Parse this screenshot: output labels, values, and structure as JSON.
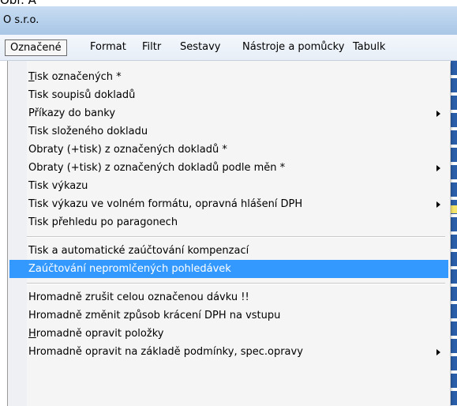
{
  "caption": "Obr. A",
  "window": {
    "title": "O s.r.o."
  },
  "menubar": {
    "items": [
      "Označené",
      "Format",
      "Filtr",
      "Sestavy",
      "Nástroje a pomůcky",
      "Tabulk"
    ]
  },
  "menu": {
    "groups": [
      [
        {
          "label": "Tisk označených *",
          "mnemonic": "T",
          "submenu": false
        },
        {
          "label": "Tisk soupisů dokladů",
          "submenu": false
        },
        {
          "label": "Příkazy do banky",
          "submenu": true
        },
        {
          "label": "Tisk složeného dokladu",
          "submenu": false
        },
        {
          "label": "Obraty  (+tisk) z označených dokladů *",
          "submenu": false
        },
        {
          "label": "Obraty  (+tisk) z označených dokladů podle měn *",
          "submenu": true
        },
        {
          "label": "Tisk  výkazu",
          "submenu": false
        },
        {
          "label": "Tisk výkazu ve volném formátu, opravná hlášení DPH",
          "submenu": true
        },
        {
          "label": "Tisk přehledu po paragonech",
          "submenu": false
        }
      ],
      [
        {
          "label": "Tisk a automatické zaúčtování kompenzací",
          "submenu": false
        },
        {
          "label": "Zaúčtování nepromlčených pohledávek",
          "submenu": false,
          "highlighted": true
        }
      ],
      [
        {
          "label": "Hromadně zrušit celou označenou dávku !!",
          "submenu": false
        },
        {
          "label": "Hromadně změnit způsob krácení DPH na vstupu",
          "submenu": false
        },
        {
          "label": "Hromadně opravit položky",
          "mnemonic": "H",
          "submenu": false
        },
        {
          "label": "Hromadně opravit  na základě podmínky, spec.opravy",
          "submenu": true
        }
      ]
    ]
  },
  "colors": {
    "highlight": "#3399ff",
    "menu_bg": "#f5f5f5",
    "titlebar": "#b6d0ec"
  }
}
